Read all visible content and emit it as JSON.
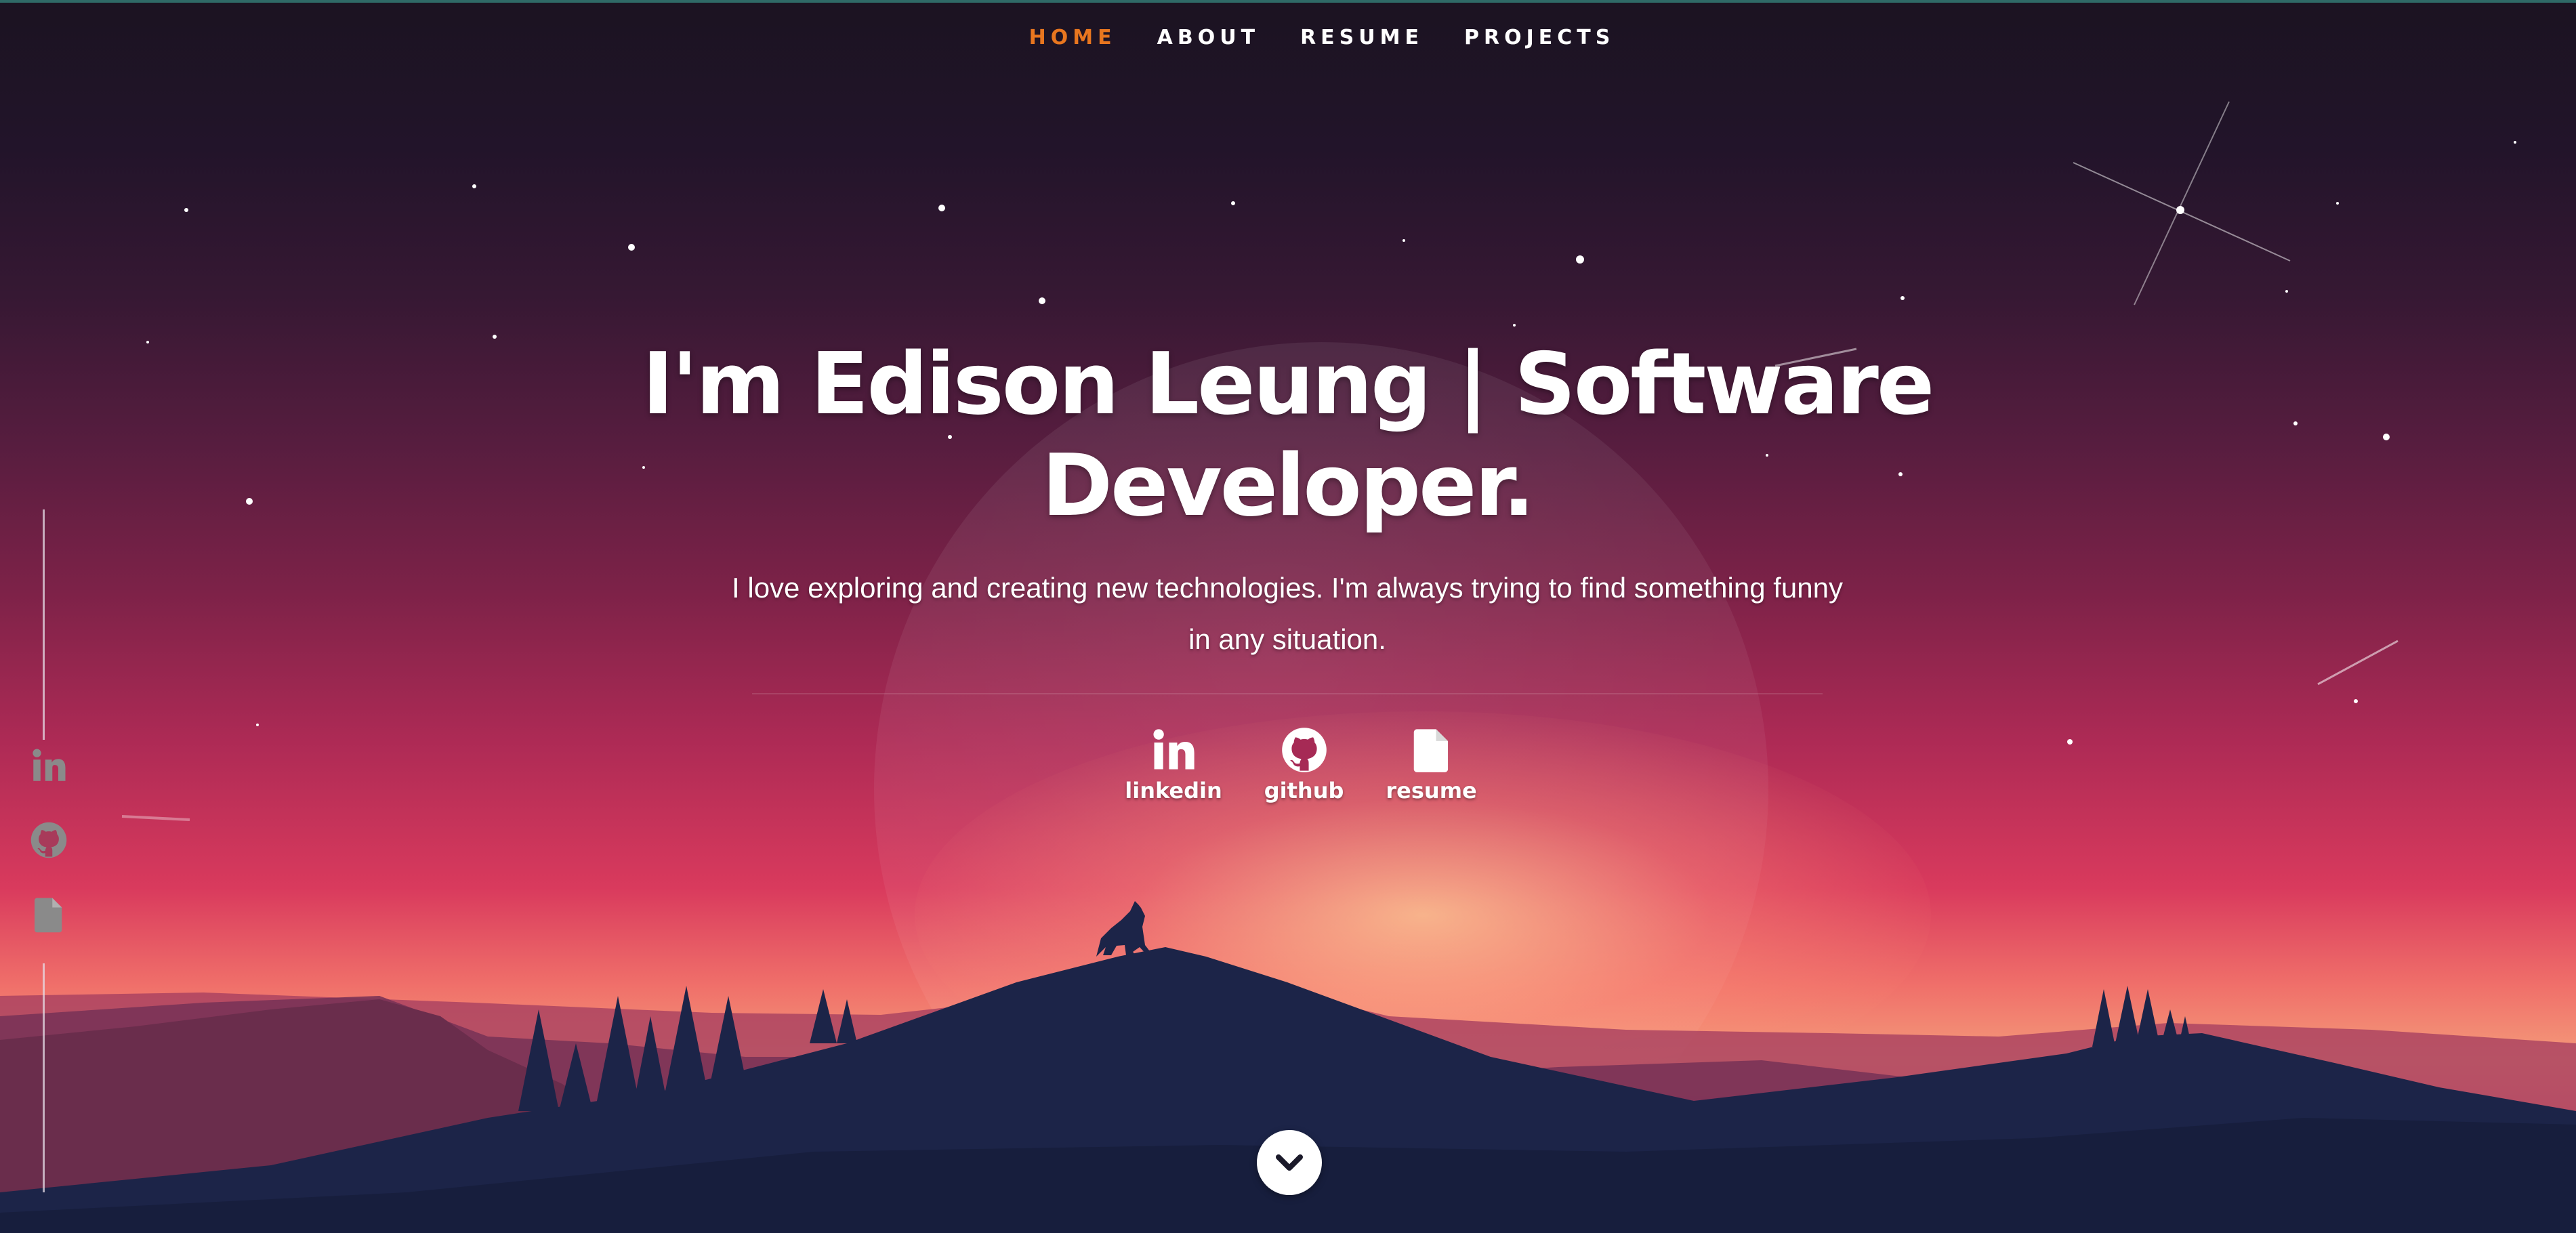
{
  "nav": {
    "items": [
      {
        "label": "HOME",
        "active": true
      },
      {
        "label": "ABOUT",
        "active": false
      },
      {
        "label": "RESUME",
        "active": false
      },
      {
        "label": "PROJECTS",
        "active": false
      }
    ]
  },
  "hero": {
    "title_line1": "I'm Edison Leung | Software",
    "title_line2": "Developer.",
    "subtitle_line1": "I love exploring and creating new technologies. I'm always trying to find something funny",
    "subtitle_line2": "in any situation."
  },
  "social": [
    {
      "label": "linkedin",
      "icon": "linkedin-icon"
    },
    {
      "label": "github",
      "icon": "github-icon"
    },
    {
      "label": "resume",
      "icon": "file-icon"
    }
  ],
  "sidebar": {
    "icons": [
      "linkedin-icon",
      "github-icon",
      "file-icon"
    ]
  },
  "scroll_button": {
    "icon": "chevron-down-icon"
  },
  "colors": {
    "accent": "#e8761f",
    "text": "#ffffff",
    "sky_top": "#1b1321",
    "sky_mid": "#ad2a55",
    "horizon": "#f49b7a",
    "mountain": "#1b2446"
  }
}
